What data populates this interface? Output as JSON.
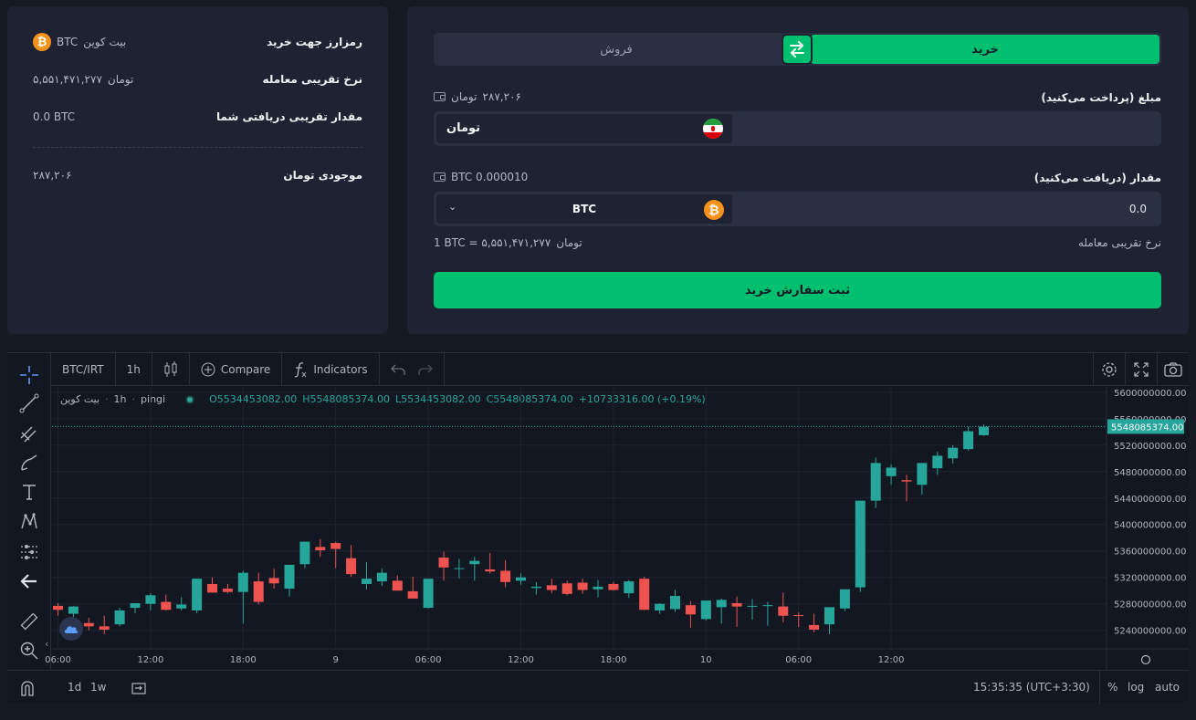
{
  "summary": {
    "buy_currency_label": "رمزارز جهت خرید",
    "buy_currency_name": "بیت کوین",
    "buy_currency_symbol": "BTC",
    "rate_label": "نرخ تقریبی معامله",
    "rate_value": "۵,۵۵۱,۴۷۱,۲۷۷",
    "rate_unit": "تومان",
    "receive_label": "مقدار تقریبی دریافتی شما",
    "receive_value": "0.0 BTC",
    "balance_label": "موجودی تومان",
    "balance_value": "۲۸۷,۲۰۶"
  },
  "trade": {
    "tab_buy": "خرید",
    "tab_sell": "فروش",
    "pay_label": "مبلغ (پرداخت می‌کنید)",
    "pay_balance_value": "۲۸۷,۲۰۶",
    "pay_balance_unit": "تومان",
    "pay_currency": "تومان",
    "receive_label": "مقدار (دریافت می‌کنید)",
    "receive_balance": "BTC 0.000010",
    "receive_currency": "BTC",
    "receive_value": "0.0",
    "rate_label": "نرخ تقریبی معامله",
    "rate_text": "1 BTC = ۵,۵۵۱,۴۷۱,۲۷۷",
    "rate_unit": "تومان",
    "submit_label": "ثبت سفارش خرید"
  },
  "chart_toolbar": {
    "symbol": "BTC/IRT",
    "interval": "1h",
    "compare": "Compare",
    "indicators": "Indicators"
  },
  "legend": {
    "name": "بیت کوین",
    "interval": "1h",
    "source": "pingi",
    "open": "O5534453082.00",
    "high": "H5548085374.00",
    "low": "L5534453082.00",
    "close": "C5548085374.00",
    "change": "+10733316.00 (+0.19%)"
  },
  "chart_bottom": {
    "range_1d": "1d",
    "range_1w": "1w",
    "time": "15:35:35 (UTC+3:30)",
    "percent": "%",
    "log": "log",
    "auto": "auto"
  },
  "colors": {
    "up": "#26a69a",
    "down": "#ef5350",
    "accent": "#00c070",
    "bg": "#1e2232"
  },
  "chart_data": {
    "type": "candlestick",
    "last_price_label": "5548085374.00",
    "last_price": 5548085374,
    "ylim": [
      5212000000,
      5608000000
    ],
    "y_ticks": [
      "5240000000.00",
      "5280000000.00",
      "5320000000.00",
      "5360000000.00",
      "5400000000.00",
      "5440000000.00",
      "5480000000.00",
      "5520000000.00",
      "5560000000.00",
      "5600000000.00"
    ],
    "y_tick_values": [
      5240000000,
      5280000000,
      5320000000,
      5360000000,
      5400000000,
      5440000000,
      5480000000,
      5520000000,
      5560000000,
      5600000000
    ],
    "x_ticks": [
      "06:00",
      "12:00",
      "18:00",
      "9",
      "06:00",
      "12:00",
      "18:00",
      "10",
      "06:00",
      "12:00"
    ],
    "x_tick_index": [
      0,
      6,
      12,
      18,
      24,
      30,
      36,
      42,
      48,
      54
    ],
    "candles_ohlc_million": [
      [
        5277,
        5281,
        5262,
        5271
      ],
      [
        5265,
        5277,
        5258,
        5276
      ],
      [
        5251,
        5259,
        5240,
        5246
      ],
      [
        5246,
        5262,
        5234,
        5241
      ],
      [
        5249,
        5274,
        5246,
        5270
      ],
      [
        5274,
        5280,
        5266,
        5281
      ],
      [
        5280,
        5296,
        5270,
        5293
      ],
      [
        5283,
        5294,
        5270,
        5271
      ],
      [
        5273,
        5290,
        5270,
        5279
      ],
      [
        5270,
        5318,
        5266,
        5318
      ],
      [
        5310,
        5320,
        5297,
        5297
      ],
      [
        5303,
        5310,
        5296,
        5298
      ],
      [
        5298,
        5330,
        5250,
        5327
      ],
      [
        5314,
        5327,
        5279,
        5283
      ],
      [
        5319,
        5333,
        5303,
        5311
      ],
      [
        5303,
        5339,
        5291,
        5339
      ],
      [
        5340,
        5356,
        5334,
        5374
      ],
      [
        5366,
        5378,
        5351,
        5361
      ],
      [
        5372,
        5374,
        5334,
        5363
      ],
      [
        5349,
        5369,
        5321,
        5325
      ],
      [
        5310,
        5343,
        5302,
        5318
      ],
      [
        5314,
        5333,
        5307,
        5327
      ],
      [
        5315,
        5323,
        5300,
        5300
      ],
      [
        5299,
        5321,
        5288,
        5288
      ],
      [
        5274,
        5317,
        5273,
        5318
      ],
      [
        5350,
        5359,
        5315,
        5335
      ],
      [
        5333,
        5348,
        5318,
        5334
      ],
      [
        5340,
        5351,
        5315,
        5345
      ],
      [
        5332,
        5357,
        5326,
        5329
      ],
      [
        5330,
        5346,
        5305,
        5313
      ],
      [
        5315,
        5326,
        5309,
        5320
      ],
      [
        5304,
        5313,
        5294,
        5306
      ],
      [
        5308,
        5318,
        5296,
        5301
      ],
      [
        5311,
        5315,
        5293,
        5295
      ],
      [
        5312,
        5318,
        5295,
        5301
      ],
      [
        5302,
        5316,
        5290,
        5306
      ],
      [
        5310,
        5313,
        5300,
        5301
      ],
      [
        5296,
        5316,
        5289,
        5314
      ],
      [
        5318,
        5321,
        5271,
        5271
      ],
      [
        5270,
        5281,
        5265,
        5280
      ],
      [
        5272,
        5301,
        5268,
        5292
      ],
      [
        5278,
        5284,
        5244,
        5264
      ],
      [
        5257,
        5284,
        5255,
        5285
      ],
      [
        5275,
        5288,
        5250,
        5286
      ],
      [
        5281,
        5291,
        5245,
        5276
      ],
      [
        5276,
        5287,
        5256,
        5277
      ],
      [
        5278,
        5283,
        5247,
        5278
      ],
      [
        5276,
        5297,
        5252,
        5262
      ],
      [
        5263,
        5267,
        5245,
        5262
      ],
      [
        5248,
        5265,
        5237,
        5241
      ],
      [
        5249,
        5268,
        5234,
        5275
      ],
      [
        5273,
        5302,
        5269,
        5302
      ],
      [
        5305,
        5304,
        5298,
        5436
      ],
      [
        5436,
        5501,
        5425,
        5493
      ],
      [
        5473,
        5491,
        5460,
        5486
      ],
      [
        5467,
        5475,
        5435,
        5465
      ],
      [
        5460,
        5490,
        5445,
        5493
      ],
      [
        5485,
        5510,
        5475,
        5504
      ],
      [
        5500,
        5520,
        5492,
        5516
      ],
      [
        5514,
        5548,
        5512,
        5541
      ],
      [
        5535,
        5551,
        5534,
        5548
      ]
    ]
  }
}
